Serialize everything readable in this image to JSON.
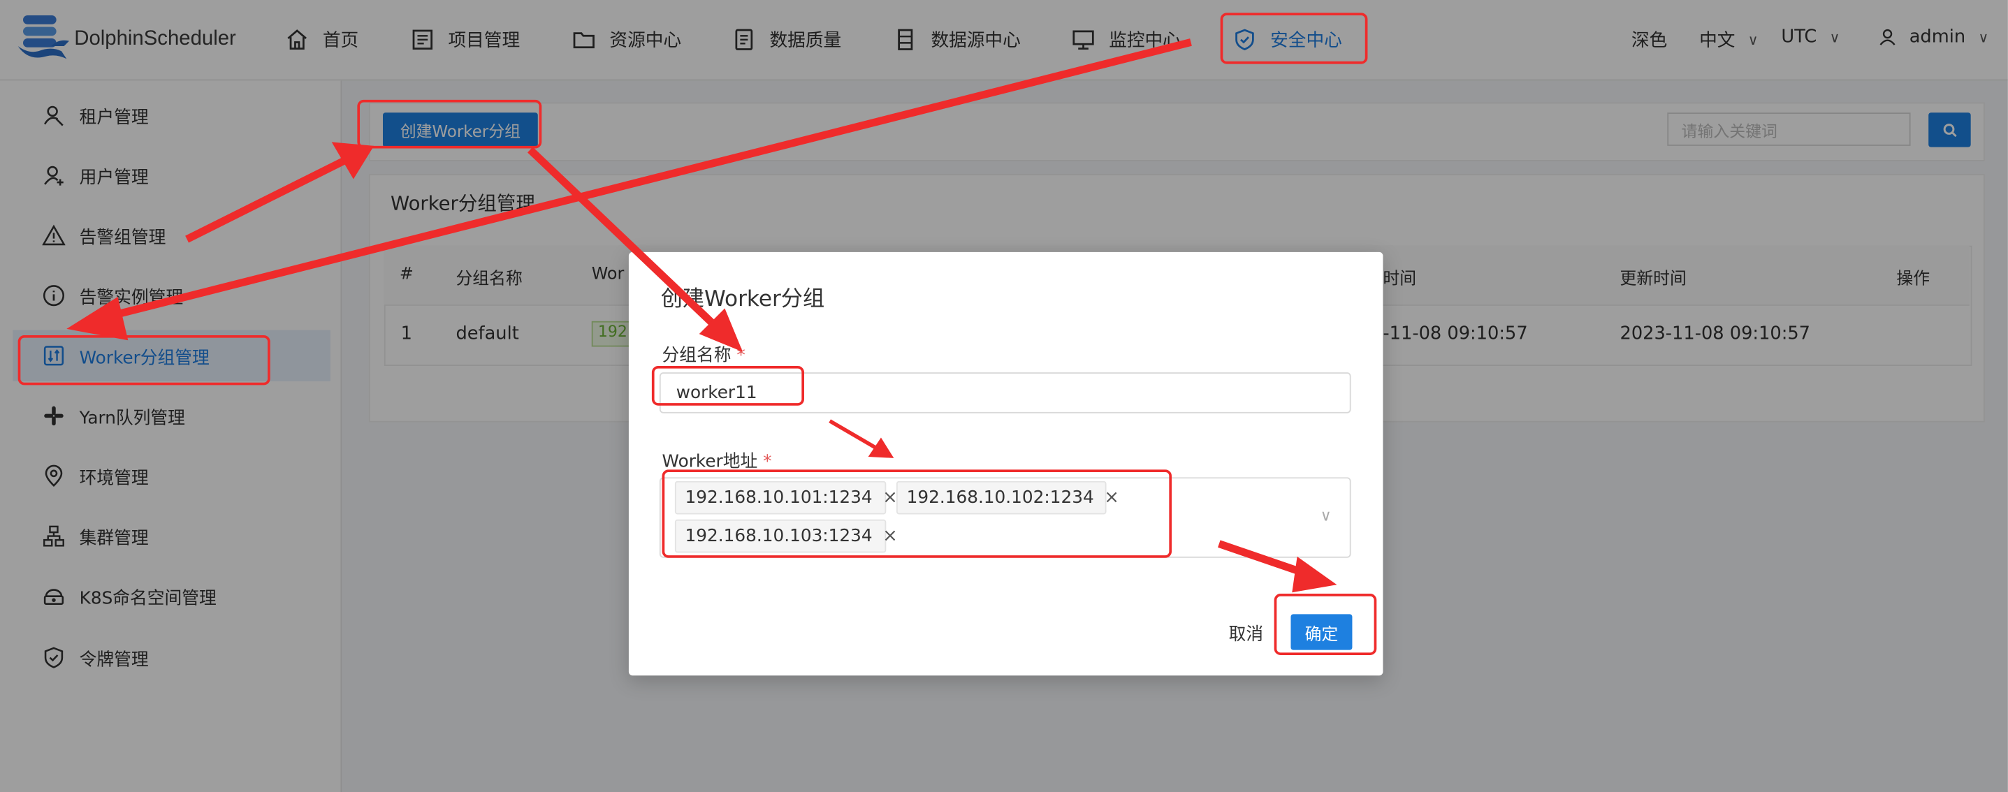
{
  "app": {
    "name": "DolphinScheduler"
  },
  "header": {
    "nav": [
      {
        "label": "首页",
        "icon": "home-icon"
      },
      {
        "label": "项目管理",
        "icon": "project-icon"
      },
      {
        "label": "资源中心",
        "icon": "folder-icon"
      },
      {
        "label": "数据质量",
        "icon": "data-quality-icon"
      },
      {
        "label": "数据源中心",
        "icon": "datasource-icon"
      },
      {
        "label": "监控中心",
        "icon": "monitor-icon"
      },
      {
        "label": "安全中心",
        "icon": "shield-icon",
        "active": true
      }
    ],
    "theme_label": "深色",
    "language": "中文",
    "timezone": "UTC",
    "user": "admin"
  },
  "sidebar": {
    "items": [
      {
        "label": "租户管理",
        "icon": "tenant-icon"
      },
      {
        "label": "用户管理",
        "icon": "user-add-icon"
      },
      {
        "label": "告警组管理",
        "icon": "warning-icon"
      },
      {
        "label": "告警实例管理",
        "icon": "info-icon"
      },
      {
        "label": "Worker分组管理",
        "icon": "worker-group-icon",
        "active": true
      },
      {
        "label": "Yarn队列管理",
        "icon": "yarn-icon"
      },
      {
        "label": "环境管理",
        "icon": "location-icon"
      },
      {
        "label": "集群管理",
        "icon": "cluster-icon"
      },
      {
        "label": "K8S命名空间管理",
        "icon": "k8s-icon"
      },
      {
        "label": "令牌管理",
        "icon": "token-shield-icon"
      }
    ]
  },
  "toolbar": {
    "create_label": "创建Worker分组",
    "search_placeholder": "请输入关键词"
  },
  "panel": {
    "title": "Worker分组管理",
    "columns": [
      "#",
      "分组名称",
      "Wor",
      "时间",
      "更新时间",
      "操作"
    ],
    "rows": [
      {
        "index": "1",
        "name": "default",
        "address": "192",
        "create_time": "-11-08 09:10:57",
        "update_time": "2023-11-08 09:10:57"
      }
    ]
  },
  "modal": {
    "title": "创建Worker分组",
    "name_label": "分组名称",
    "name_value": "worker11",
    "address_label": "Worker地址",
    "addresses": [
      "192.168.10.101:1234",
      "192.168.10.102:1234",
      "192.168.10.103:1234"
    ],
    "remove_glyph": "×",
    "required_mark": "*",
    "cancel_label": "取消",
    "ok_label": "确定"
  },
  "colors": {
    "accent": "#1e80e0",
    "annotation_red": "#ef2b2b",
    "active_bg": "#e7f1fc"
  }
}
